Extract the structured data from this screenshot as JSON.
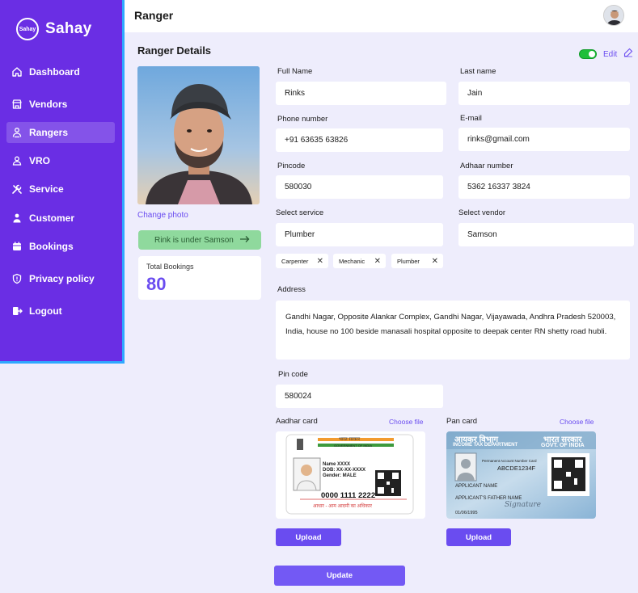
{
  "brand": {
    "logo_text": "Sahay",
    "name": "Sahay"
  },
  "sidebar": {
    "items": [
      {
        "label": "Dashboard",
        "icon": "home-icon"
      },
      {
        "label": "Vendors",
        "icon": "store-icon"
      },
      {
        "label": "Rangers",
        "icon": "rangers-icon"
      },
      {
        "label": "VRO",
        "icon": "user-icon"
      },
      {
        "label": "Service",
        "icon": "tools-icon"
      },
      {
        "label": "Customer",
        "icon": "customer-icon"
      },
      {
        "label": "Bookings",
        "icon": "calendar-icon"
      },
      {
        "label": "Privacy policy",
        "icon": "shield-icon"
      },
      {
        "label": "Logout",
        "icon": "logout-icon"
      }
    ],
    "active": "Rangers"
  },
  "header": {
    "title": "Ranger"
  },
  "section": {
    "title": "Ranger Details",
    "edit_label": "Edit"
  },
  "profile": {
    "change_photo": "Change  photo",
    "vendor_note": "Rink is under Samson",
    "total_bookings_label": "Total Bookings",
    "total_bookings_value": "80"
  },
  "form": {
    "full_name_label": "Full Name",
    "full_name": "Rinks",
    "last_name_label": "Last name",
    "last_name": "Jain",
    "phone_label": "Phone number",
    "phone": "+91 63635 63826",
    "email_label": "E-mail",
    "email": "rinks@gmail.com",
    "pincode_label": "Pincode",
    "pincode": "580030",
    "adhaar_label": "Adhaar number",
    "adhaar": "5362 16337 3824",
    "service_label": "Select service",
    "service": "Plumber",
    "vendor_label": "Select vendor",
    "vendor": "Samson",
    "service_chips": [
      "Carpenter",
      "Mechanic",
      "Plumber"
    ],
    "address_label": "Address",
    "address": "Gandhi Nagar, Opposite Alankar Complex, Gandhi Nagar, Vijayawada, Andhra Pradesh 520003, India, house no 100 beside manasali hospital opposite to deepak center RN shetty road hubli.",
    "pin_code_label": "Pin code",
    "pin_code": "580024"
  },
  "documents": {
    "aadhar_label": "Aadhar card",
    "pan_label": "Pan card",
    "choose_file": "Choose file",
    "upload_label": "Upload",
    "aadhar_card": {
      "gov_line1": "भारत सरकार",
      "gov_line2": "GOVERNMENT OF INDIA",
      "name": "Name XXXX",
      "dob": "DOB: XX-XX-XXXX",
      "gender": "Gender: MALE",
      "number": "0000 1111 2222",
      "footer": "आधार - आम आदमी का अधिकार"
    },
    "pan_card": {
      "dept_hi": "आयकर विभाग",
      "gov_hi": "भारत सरकार",
      "dept_en": "INCOME TAX DEPARTMENT",
      "gov_en": "GOVT. OF INDIA",
      "card_title": "Permanent Account Number Card",
      "pan": "ABCDE1234F",
      "name": "APPLICANT NAME",
      "father": "APPLICANT'S FATHER NAME",
      "dob": "01/06/1995",
      "signature": "Signature"
    }
  },
  "actions": {
    "update_label": "Update"
  },
  "colors": {
    "sidebar": "#6a2ee4",
    "accent": "#6a4cf0",
    "background": "#eeedfc",
    "toggle_on": "#1fbf3a",
    "success_pill": "#8fd99d"
  }
}
